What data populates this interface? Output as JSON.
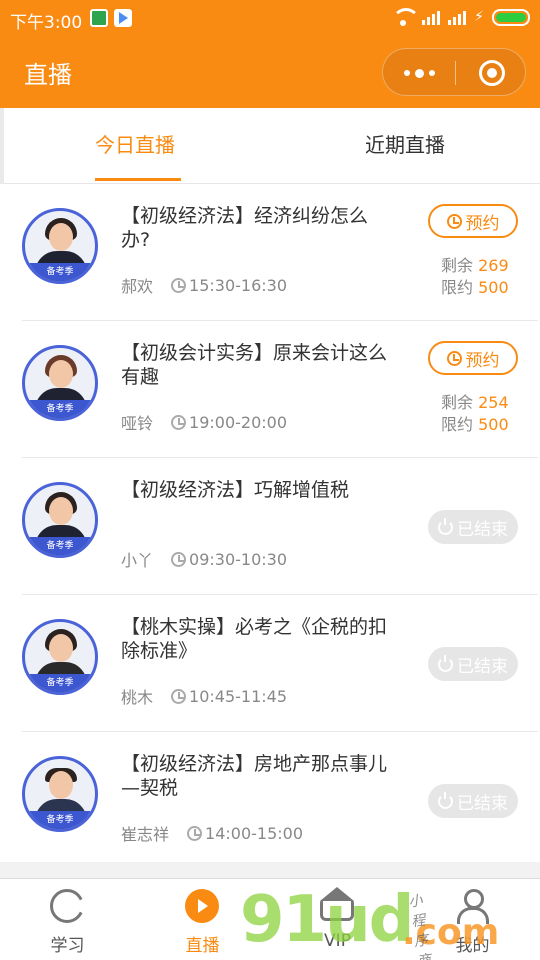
{
  "status_bar": {
    "time": "下午3:00"
  },
  "header": {
    "title": "直播"
  },
  "tabs": [
    {
      "label": "今日直播",
      "active": true
    },
    {
      "label": "近期直播",
      "active": false
    }
  ],
  "avatar_badge": "备考季",
  "items": [
    {
      "title": "【初级经济法】经济纠纷怎么办?",
      "teacher": "郝欢",
      "time": "15:30-16:30",
      "status": "reserve",
      "button": "预约",
      "remaining_label": "剩余",
      "remaining": "269",
      "limit_label": "限约",
      "limit": "500"
    },
    {
      "title": "【初级会计实务】原来会计这么有趣",
      "teacher": "哑铃",
      "time": "19:00-20:00",
      "status": "reserve",
      "button": "预约",
      "remaining_label": "剩余",
      "remaining": "254",
      "limit_label": "限约",
      "limit": "500"
    },
    {
      "title": "【初级经济法】巧解增值税",
      "teacher": "小丫",
      "time": "09:30-10:30",
      "status": "ended",
      "button": "已结束"
    },
    {
      "title": "【桃木实操】必考之《企税的扣除标准》",
      "teacher": "桃木",
      "time": "10:45-11:45",
      "status": "ended",
      "button": "已结束"
    },
    {
      "title": "【初级经济法】房地产那点事儿—契税",
      "teacher": "崔志祥",
      "time": "14:00-15:00",
      "status": "ended",
      "button": "已结束"
    }
  ],
  "bottom_nav": [
    {
      "label": "学习",
      "icon": "study-icon",
      "active": false
    },
    {
      "label": "直播",
      "icon": "live-play-icon",
      "active": true
    },
    {
      "label": "VIP",
      "icon": "vip-crown-icon",
      "active": false
    },
    {
      "label": "我的",
      "icon": "user-icon",
      "active": false
    }
  ],
  "watermark": {
    "main": "91ud",
    "suffix": ".com",
    "sub": "小程序商店"
  },
  "colors": {
    "accent": "#f98b13",
    "avatar_ring": "#4a63d9",
    "ended_button": "#e6e6e6"
  }
}
